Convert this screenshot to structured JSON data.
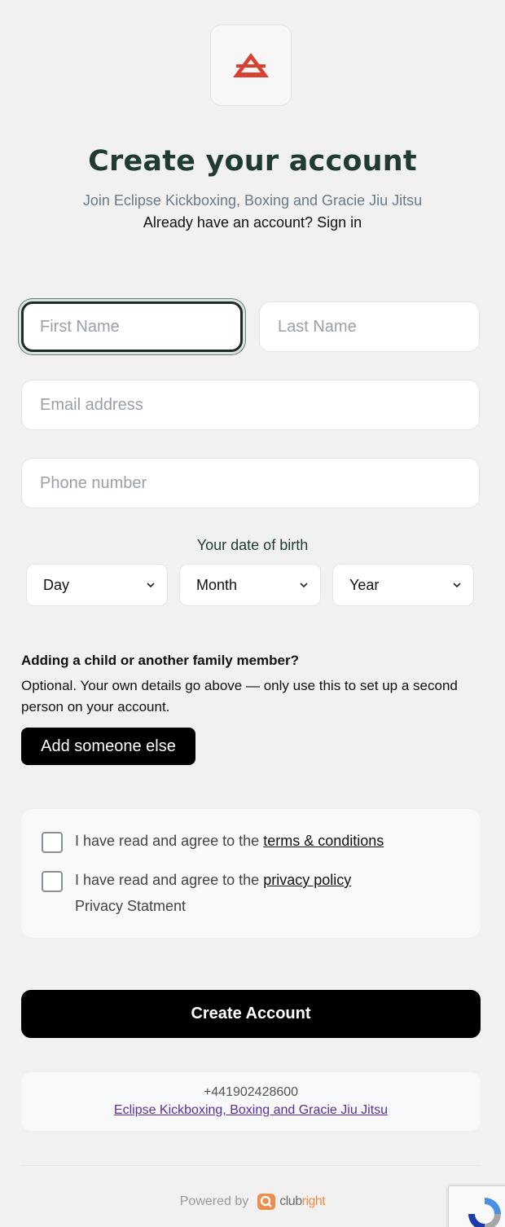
{
  "header": {
    "logo_icon": "club-logo",
    "title": "Create your account",
    "subtitle": "Join Eclipse Kickboxing, Boxing and Gracie Jiu Jitsu",
    "signin_prefix": "Already have an account?",
    "signin_link": "Sign in"
  },
  "form": {
    "first_name": {
      "placeholder": "First Name",
      "value": ""
    },
    "last_name": {
      "placeholder": "Last Name",
      "value": ""
    },
    "email": {
      "placeholder": "Email address",
      "value": ""
    },
    "phone": {
      "placeholder": "Phone number",
      "value": ""
    },
    "dob_label": "Your date of birth",
    "day": "Day",
    "month": "Month",
    "year": "Year"
  },
  "family": {
    "title": "Adding a child or another family member?",
    "description": "Optional. Your own details go above — only use this to set up a second person on your account.",
    "button": "Add someone else"
  },
  "agreements": {
    "terms_prefix": "I have read and agree to the",
    "terms_link": "terms & conditions",
    "privacy_prefix": "I have read and agree to the",
    "privacy_link": "privacy policy",
    "privacy_statement": "Privacy Statment"
  },
  "submit": {
    "label": "Create Account"
  },
  "contact": {
    "phone": "+441902428600",
    "club_link": "Eclipse Kickboxing, Boxing and Gracie Jiu Jitsu"
  },
  "footer": {
    "powered_by": "Powered by",
    "brand_a": "club",
    "brand_b": "right"
  },
  "colors": {
    "title": "#1f3b33",
    "accent_red": "#d8412f",
    "brand_orange": "#f08c4a",
    "link_purple": "#5b2ca0"
  }
}
